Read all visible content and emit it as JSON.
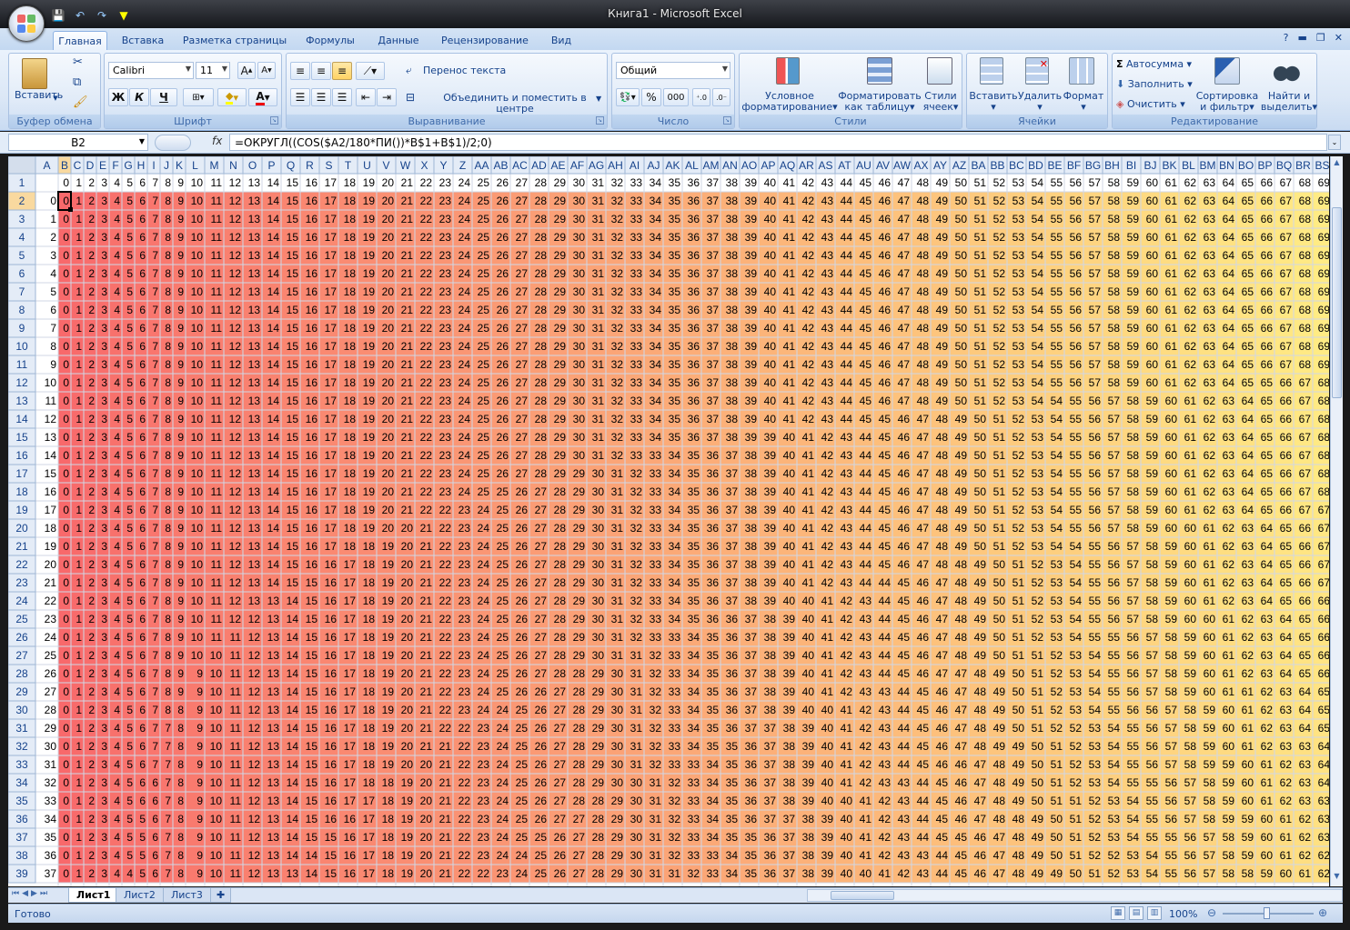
{
  "window": {
    "title": "Книга1 - Microsoft Excel"
  },
  "qat": {
    "save": "save-icon",
    "undo": "undo-icon",
    "redo": "redo-icon",
    "fill": "fill-color-icon"
  },
  "tabs": [
    "Главная",
    "Вставка",
    "Разметка страницы",
    "Формулы",
    "Данные",
    "Рецензирование",
    "Вид"
  ],
  "active_tab": "Главная",
  "ribbon": {
    "clipboard": {
      "caption": "Буфер обмена",
      "paste": "Вставить"
    },
    "font": {
      "caption": "Шрифт",
      "name": "Calibri",
      "size": "11",
      "bold": "Ж",
      "italic": "К",
      "underline": "Ч"
    },
    "alignment": {
      "caption": "Выравнивание",
      "wrap": "Перенос текста",
      "merge": "Объединить и поместить в центре"
    },
    "number": {
      "caption": "Число",
      "format": "Общий",
      "percent": "%",
      "thousands": "000"
    },
    "styles": {
      "caption": "Стили",
      "cond1": "Условное",
      "cond2": "форматирование",
      "fmt1": "Форматировать",
      "fmt2": "как таблицу",
      "cell1": "Стили",
      "cell2": "ячеек"
    },
    "cells": {
      "caption": "Ячейки",
      "insert": "Вставить",
      "delete": "Удалить",
      "format": "Формат"
    },
    "editing": {
      "caption": "Редактирование",
      "autosum": "Автосумма",
      "fill": "Заполнить",
      "clear": "Очистить",
      "sort1": "Сортировка",
      "sort2": "и фильтр",
      "find1": "Найти и",
      "find2": "выделить"
    }
  },
  "formula_bar": {
    "name_box": "B2",
    "fx": "fx",
    "formula": "=ОКРУГЛ((COS($A2/180*ПИ())*B$1+B$1)/2;0)"
  },
  "grid": {
    "columns": [
      "A",
      "B",
      "C",
      "D",
      "E",
      "F",
      "G",
      "H",
      "I",
      "J",
      "K",
      "L",
      "M",
      "N",
      "O",
      "P",
      "Q",
      "R",
      "S",
      "T",
      "U",
      "V",
      "W",
      "X",
      "Y",
      "Z",
      "AA",
      "AB",
      "AC",
      "AD",
      "AE",
      "AF",
      "AG",
      "AH",
      "AI",
      "AJ",
      "AK",
      "AL",
      "AM",
      "AN",
      "AO",
      "AP",
      "AQ",
      "AR",
      "AS",
      "AT",
      "AU",
      "AV",
      "AW",
      "AX",
      "AY",
      "AZ",
      "BA",
      "BB",
      "BC",
      "BD",
      "BE",
      "BF",
      "BG",
      "BH",
      "BI",
      "BJ",
      "BK",
      "BL",
      "BM",
      "BN",
      "BO",
      "BP",
      "BQ",
      "BR",
      "BS"
    ],
    "first_row": 1,
    "last_row": 39,
    "header_values_row1": "0..69",
    "a_column_values": "0..37",
    "selected_cell": "B2",
    "color_scale": [
      "#f8696b",
      "#ffeb84"
    ]
  },
  "sheets": [
    "Лист1",
    "Лист2",
    "Лист3"
  ],
  "active_sheet": "Лист1",
  "status": {
    "ready": "Готово",
    "zoom": "100%"
  }
}
